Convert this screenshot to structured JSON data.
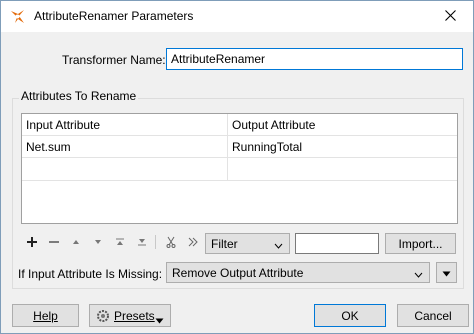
{
  "window": {
    "title": "AttributeRenamer Parameters",
    "icons": {
      "app": "transformer-icon",
      "close": "close-icon"
    }
  },
  "transformer_name": {
    "label": "Transformer Name:",
    "value": "AttributeRenamer"
  },
  "attributes": {
    "group_title": "Attributes To Rename",
    "columns": [
      "Input Attribute",
      "Output Attribute"
    ],
    "rows": [
      {
        "input": "Net.sum",
        "output": "RunningTotal"
      }
    ]
  },
  "toolbar": {
    "icons": [
      "add-icon",
      "remove-icon",
      "move-up-icon",
      "move-down-icon",
      "move-top-icon",
      "move-bottom-icon",
      "cut-icon",
      "expand-icon"
    ],
    "filter_select": "Filter",
    "filter_text": "",
    "import_button": "Import..."
  },
  "missing": {
    "label": "If Input Attribute Is Missing:",
    "selected": "Remove Output Attribute"
  },
  "footer": {
    "help": "Help",
    "presets": "Presets",
    "ok": "OK",
    "cancel": "Cancel"
  },
  "colors": {
    "accent": "#0078d7",
    "window_bg": "#f0f0f0",
    "button_bg": "#e1e1e1"
  }
}
